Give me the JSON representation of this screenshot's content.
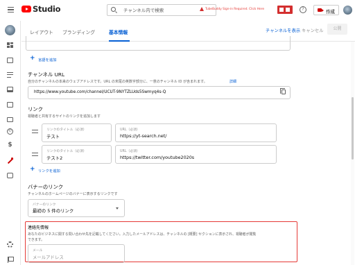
{
  "header": {
    "app_title": "Studio",
    "search_placeholder": "チャンネル内で検索",
    "tubebuddy_warning": "TubeBuddy Sign-in Required. Click Here",
    "create_label": "作成"
  },
  "tabs": {
    "items": [
      {
        "label": "レイアウト"
      },
      {
        "label": "ブランディング"
      },
      {
        "label": "基本情報"
      }
    ],
    "active_index": 2,
    "view_channel": "チャンネルを表示",
    "cancel": "キャンセル",
    "publish": "公開"
  },
  "main": {
    "add_language": "言語を追加",
    "channel_url": {
      "title": "チャンネル URL",
      "description": "自分のチャンネルの本来のウェブアドレスです。URL の末尾の英数字部分に、一意のチャンネル ID が含まれます。",
      "details_link": "詳細",
      "value": "https://www.youtube.com/channel/UCUT-9NYTZLUds5Swmyq4s-Q"
    },
    "links": {
      "title": "リンク",
      "description": "視聴者と共有するサイトのリンクを追加します",
      "title_label": "リンクのタイトル（必須）",
      "url_label": "URL（必須）",
      "items": [
        {
          "title": "テスト",
          "url": "https://yt-search.net/"
        },
        {
          "title": "テスト2",
          "url": "https://twitter.com/youtube2020s"
        }
      ],
      "add_link": "リンクを追加"
    },
    "banner_links": {
      "title": "バナーのリンク",
      "description": "チャンネルのホームページのバナーに表示するリンクです",
      "select_label": "バナーのリンク",
      "select_value": "最初の 5 件のリンク"
    },
    "contact": {
      "title": "連絡先情報",
      "description_line1": "あなたのビジネスに関する問い合わせ先を記載してください。入力したメールアドレスは、チャンネルの [概要] セクションに表示され、視聴者が閲覧",
      "description_line2": "できます。",
      "email_label": "メール",
      "email_placeholder": "メールアドレス"
    }
  },
  "colors": {
    "accent_blue": "#065fd4",
    "brand_red": "#ff0000",
    "highlight_red": "#e53935"
  }
}
